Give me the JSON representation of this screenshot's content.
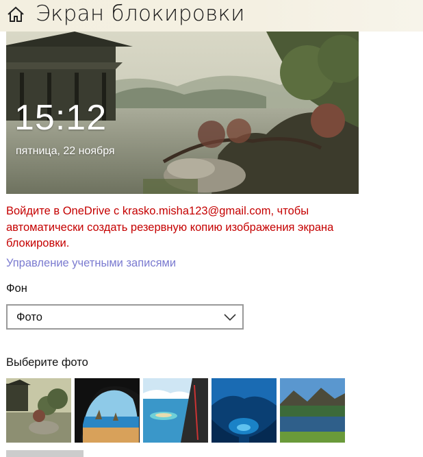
{
  "header": {
    "title": "Экран блокировки",
    "home_icon": "home-icon"
  },
  "preview": {
    "time": "15:12",
    "date": "пятница, 22 ноября"
  },
  "warning": {
    "text": "Войдите в OneDrive с krasko.misha123@gmail.com, чтобы автоматически создать резервную копию изображения экрана блокировки."
  },
  "links": {
    "manage_accounts": "Управление учетными записями"
  },
  "background": {
    "label": "Фон",
    "selected": "Фото"
  },
  "photos": {
    "label": "Выберите фото",
    "items": [
      {
        "name": "pagoda-lake"
      },
      {
        "name": "cave-beach"
      },
      {
        "name": "aerial-sea"
      },
      {
        "name": "ice-cave"
      },
      {
        "name": "mountain-lake"
      }
    ]
  },
  "colors": {
    "warning": "#c50000",
    "link": "#7b7bd0",
    "header_bg": "#f3efe0"
  }
}
